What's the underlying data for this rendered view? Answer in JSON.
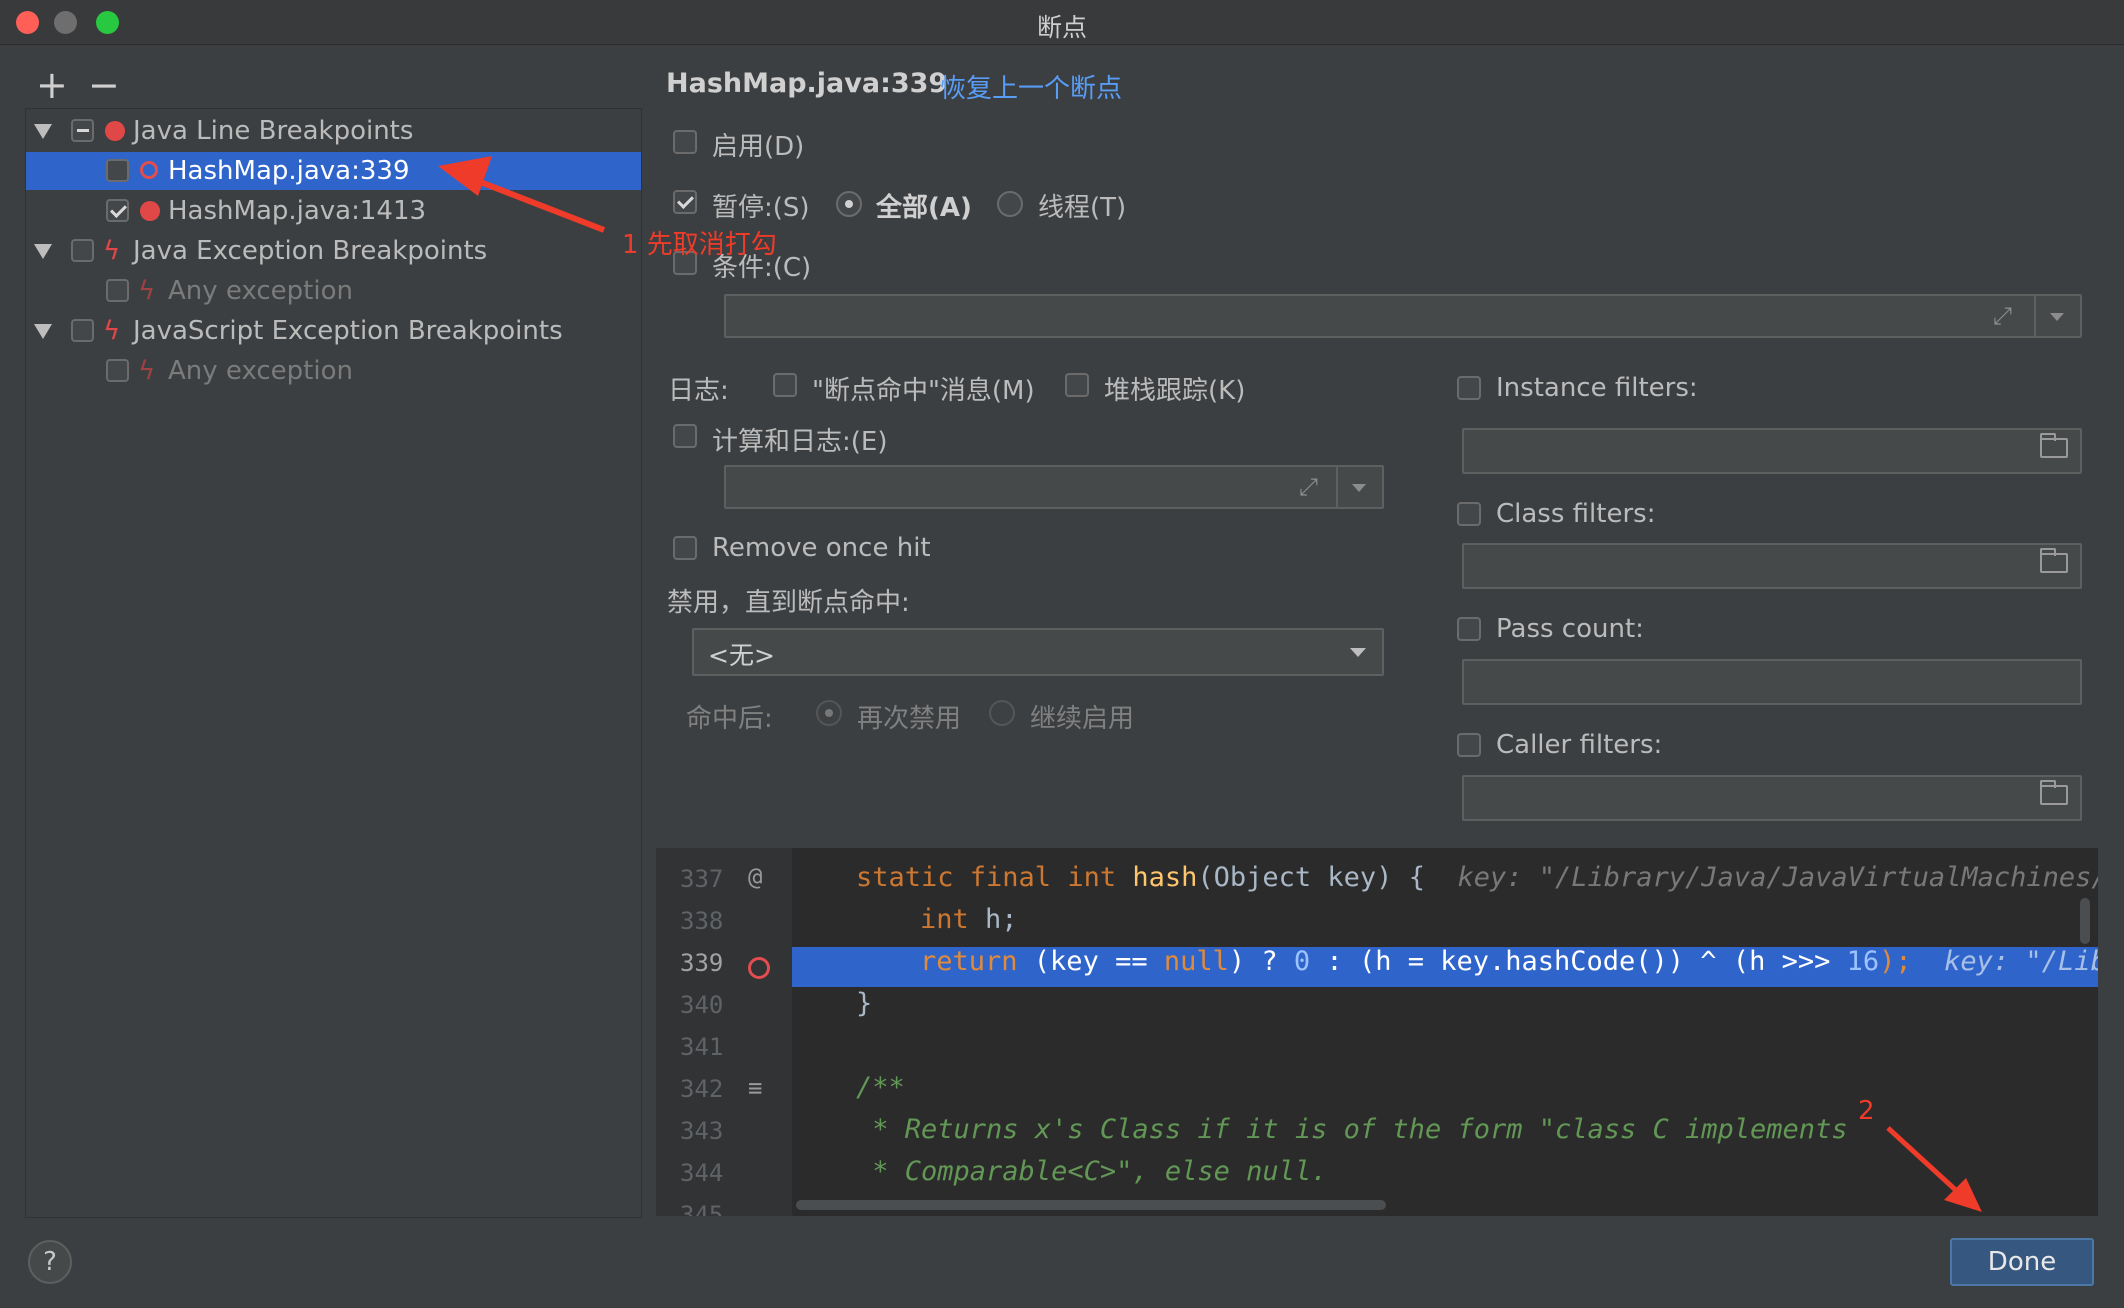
{
  "window": {
    "title": "断点"
  },
  "toolbar": {
    "add": "+",
    "remove": "−"
  },
  "tree": {
    "items": [
      {
        "label": "Java Line Breakpoints"
      },
      {
        "label": "HashMap.java:339"
      },
      {
        "label": "HashMap.java:1413"
      },
      {
        "label": "Java Exception Breakpoints"
      },
      {
        "label": "Any exception"
      },
      {
        "label": "JavaScript Exception Breakpoints"
      },
      {
        "label": "Any exception"
      }
    ]
  },
  "details": {
    "title": "HashMap.java:339",
    "restore_link": "恢复上一个断点",
    "enabled_label": "启用(D)",
    "suspend_label": "暂停:(S)",
    "suspend_all": "全部(A)",
    "suspend_thread": "线程(T)",
    "condition_label": "条件:(C)",
    "log_label": "日志:",
    "log_message": "\"断点命中\"消息(M)",
    "log_stack": "堆栈跟踪(K)",
    "evaluate_label": "计算和日志:(E)",
    "remove_once": "Remove once hit",
    "disable_until": "禁用，直到断点命中:",
    "disable_select": "<无>",
    "after_hit": "命中后:",
    "after_disable": "再次禁用",
    "after_enable": "继续启用",
    "instance_filters": "Instance filters:",
    "class_filters": "Class filters:",
    "pass_count": "Pass count:",
    "caller_filters": "Caller filters:"
  },
  "editor": {
    "line_numbers": [
      "337",
      "338",
      "339",
      "340",
      "341",
      "342",
      "343",
      "344",
      "345"
    ],
    "lines": {
      "l337_kw": "static final int ",
      "l337_fn": "hash",
      "l337_rest": "(Object key) {  ",
      "l337_hint": "key: \"/Library/Java/JavaVirtualMachines/j",
      "l338_kw": "int ",
      "l338_rest": "h;",
      "l339_kw1": "return ",
      "l339_a": "(key == ",
      "l339_kw2": "null",
      "l339_b": ") ? ",
      "l339_n1": "0",
      "l339_c": " : (h = key.hashCode()) ^ (h >>> ",
      "l339_n2": "16",
      "l339_d": ");  ",
      "l339_hint": "key: \"/Libr",
      "l340": "}",
      "l342": "/**",
      "l343": " * Returns x's Class if it is of the form \"class C implements",
      "l344": " * Comparable<C>\", else null."
    }
  },
  "annotations": {
    "step1": "1 先取消打勾",
    "step2": "2"
  },
  "footer": {
    "help": "?",
    "done": "Done"
  },
  "colors": {
    "selection": "#2f65ca",
    "annotation": "#ee3b2a",
    "link": "#589df6"
  }
}
